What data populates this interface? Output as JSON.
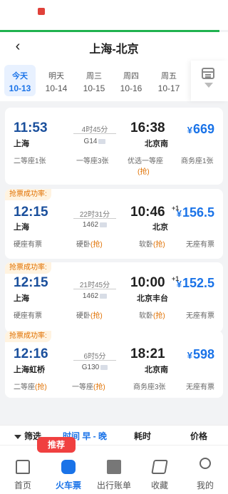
{
  "header": {
    "title": "上海-北京",
    "back_icon": "chevron-left-icon"
  },
  "dates": [
    {
      "day": "今天",
      "date": "10-13",
      "active": true
    },
    {
      "day": "明天",
      "date": "10-14"
    },
    {
      "day": "周三",
      "date": "10-15"
    },
    {
      "day": "周四",
      "date": "10-16"
    },
    {
      "day": "周五",
      "date": "10-17"
    }
  ],
  "trains": [
    {
      "dep_time": "11:53",
      "dep_station": "上海",
      "duration": "4时45分",
      "train_no": "G14",
      "arr_time": "16:38",
      "arr_station": "北京南",
      "price_symbol": "¥",
      "price": "669",
      "seats": [
        "二等座1张",
        "一等座3张",
        "优选一等座",
        "商务座1张"
      ],
      "seat_grab": "(抢)"
    },
    {
      "rate_tag": "抢票成功率:",
      "dep_time": "12:15",
      "dep_station": "上海",
      "duration": "22时31分",
      "train_no": "1462",
      "arr_time": "10:46",
      "plus_day": "+1",
      "arr_station": "北京",
      "price_symbol": "¥",
      "price": "156.5",
      "seats": [
        "硬座有票",
        "硬卧",
        "软卧",
        "无座有票"
      ],
      "seat_grab": "(抢)"
    },
    {
      "rate_tag": "抢票成功率:",
      "dep_time": "12:15",
      "dep_station": "上海",
      "duration": "21时45分",
      "train_no": "1462",
      "arr_time": "10:00",
      "plus_day": "+1",
      "arr_station": "北京丰台",
      "price_symbol": "¥",
      "price": "152.5",
      "seats": [
        "硬座有票",
        "硬卧",
        "软卧",
        "无座有票"
      ],
      "seat_grab": "(抢)"
    },
    {
      "rate_tag": "抢票成功率:",
      "dep_time": "12:16",
      "dep_station": "上海虹桥",
      "duration": "6时5分",
      "train_no": "G130",
      "arr_time": "18:21",
      "arr_station": "北京南",
      "price_symbol": "¥",
      "price": "598",
      "seats": [
        "二等座",
        "一等座",
        "商务座3张",
        "无座有票"
      ],
      "seat_grab": "(抢)"
    }
  ],
  "filters": {
    "filter": "筛选",
    "time": "时间 早 - 晚",
    "duration": "耗时",
    "price": "价格"
  },
  "tabs": [
    {
      "label": "首页",
      "icon": "home-icon"
    },
    {
      "label": "火车票",
      "icon": "train-icon",
      "active": true
    },
    {
      "label": "出行账单",
      "icon": "bill-icon"
    },
    {
      "label": "收藏",
      "icon": "ticket-icon"
    },
    {
      "label": "我的",
      "icon": "user-icon"
    }
  ],
  "recommend_badge": "推荐",
  "colors": {
    "accent": "#1a73e8",
    "departure_time": "#1a4f9c",
    "grab": "#e07000",
    "badge": "#f04040",
    "green_line": "#20b250"
  }
}
